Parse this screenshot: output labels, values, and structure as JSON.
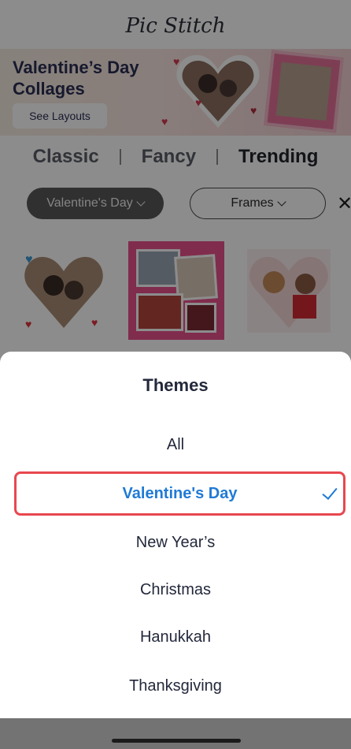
{
  "app": {
    "logo": "Pic Stitch",
    "banner": {
      "title": "Valentine’s Day Collages",
      "button_label": "See Layouts"
    },
    "tabs": [
      {
        "label": "Classic",
        "active": false
      },
      {
        "label": "Fancy",
        "active": false
      },
      {
        "label": "Trending",
        "active": true
      }
    ],
    "filters": {
      "theme_chip": "Valentine's Day",
      "frames_chip": "Frames",
      "close_icon": "close-icon"
    },
    "templates_visible": 3
  },
  "sheet": {
    "title": "Themes",
    "options": [
      {
        "label": "All",
        "selected": false
      },
      {
        "label": "Valentine's Day",
        "selected": true
      },
      {
        "label": "New Year’s",
        "selected": false
      },
      {
        "label": "Christmas",
        "selected": false
      },
      {
        "label": "Hanukkah",
        "selected": false
      },
      {
        "label": "Thanksgiving",
        "selected": false
      }
    ],
    "selected_color": "#1f7ad6",
    "highlight_border_color": "#e8474f"
  }
}
